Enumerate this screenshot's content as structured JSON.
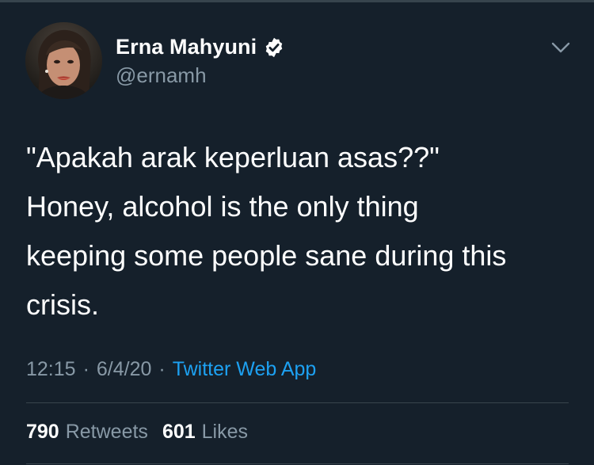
{
  "author": {
    "display_name": "Erna Mahyuni",
    "handle": "@ernamh",
    "verified": true
  },
  "tweet": {
    "text_lines": [
      "\"Apakah arak keperluan asas??\"",
      "Honey, alcohol is the only thing",
      "keeping some people sane during this",
      "crisis."
    ],
    "time": "12:15",
    "date": "6/4/20",
    "separator": "·",
    "source": "Twitter Web App"
  },
  "stats": {
    "retweets_count": "790",
    "retweets_label": "Retweets",
    "likes_count": "601",
    "likes_label": "Likes"
  },
  "icons": {
    "verified": "verified-badge-icon",
    "menu": "chevron-down-icon"
  },
  "colors": {
    "background": "#15202b",
    "accent": "#1da1f2",
    "muted_text": "#8899a6",
    "divider": "#38444d"
  }
}
